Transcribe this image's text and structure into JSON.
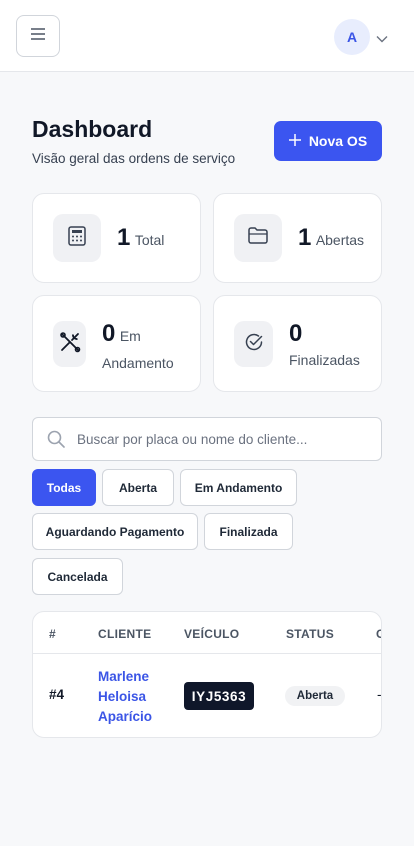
{
  "header": {
    "menu_icon": "hamburger-icon",
    "avatar_initial": "A",
    "avatar_menu_icon": "chevron-down-icon"
  },
  "page": {
    "title": "Dashboard",
    "subtitle": "Visão geral das ordens de serviço",
    "new_button_label": "Nova OS",
    "new_button_icon": "plus-icon"
  },
  "stats": [
    {
      "value": "1",
      "label": "Total",
      "icon": "calculator-icon"
    },
    {
      "value": "1",
      "label": "Abertas",
      "icon": "folder-icon"
    },
    {
      "value": "0",
      "label": "Em",
      "label2": "Andamento",
      "icon": "tools-icon"
    },
    {
      "value": "0",
      "label": "Finalizadas",
      "icon": "check-circle-icon"
    }
  ],
  "search": {
    "placeholder": "Buscar por placa ou nome do cliente...",
    "value": ""
  },
  "filters": [
    {
      "label": "Todas",
      "active": true
    },
    {
      "label": "Aberta",
      "active": false
    },
    {
      "label": "Em Andamento",
      "active": false
    },
    {
      "label": "Aguardando Pagamento",
      "active": false
    },
    {
      "label": "Finalizada",
      "active": false
    },
    {
      "label": "Cancelada",
      "active": false
    }
  ],
  "table": {
    "columns": [
      "#",
      "CLIENTE",
      "VEÍCULO",
      "STATUS",
      "C"
    ],
    "rows": [
      {
        "id": "#4",
        "client_line1": "Marlene",
        "client_line2": "Heloisa",
        "client_line3": "Aparício",
        "plate": "IYJ5363",
        "status": "Aberta",
        "extra": "-"
      }
    ]
  },
  "colors": {
    "accent": "#3b55f0",
    "link": "#3b55e6",
    "plate_bg": "#0f172a",
    "page_bg": "#f7f8fa"
  }
}
